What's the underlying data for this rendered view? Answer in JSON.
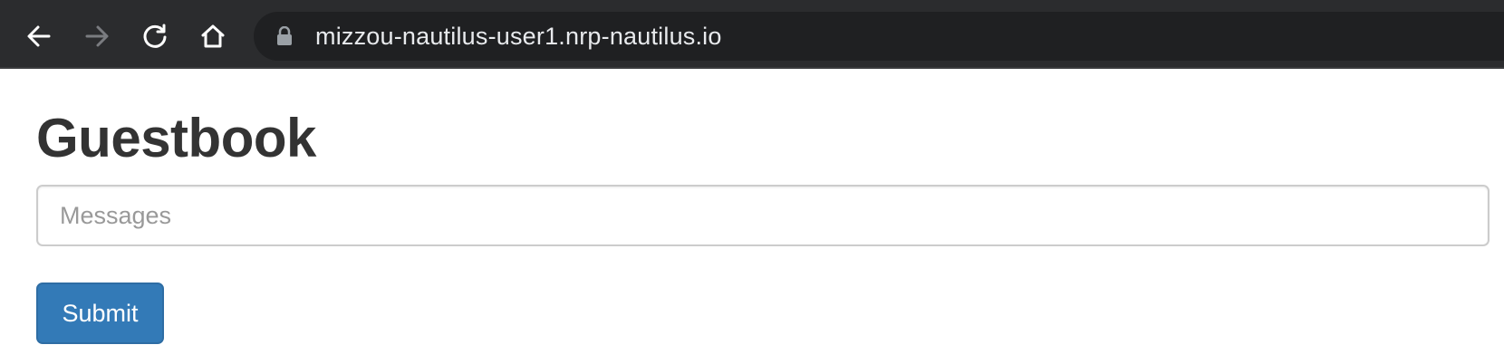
{
  "browser": {
    "url": "mizzou-nautilus-user1.nrp-nautilus.io",
    "icons": {
      "back": "arrow-left-icon",
      "forward": "arrow-right-icon",
      "reload": "reload-icon",
      "home": "home-icon",
      "lock": "lock-icon"
    },
    "colors": {
      "toolbar": "#2b2c2e",
      "omnibox": "#1f2022",
      "url_text": "#e8eaed",
      "forward_disabled": "#7a7c80"
    }
  },
  "page": {
    "title": "Guestbook",
    "message_input": {
      "placeholder": "Messages",
      "value": ""
    },
    "submit_label": "Submit",
    "colors": {
      "button": "#337ab7",
      "title": "#333333"
    }
  }
}
